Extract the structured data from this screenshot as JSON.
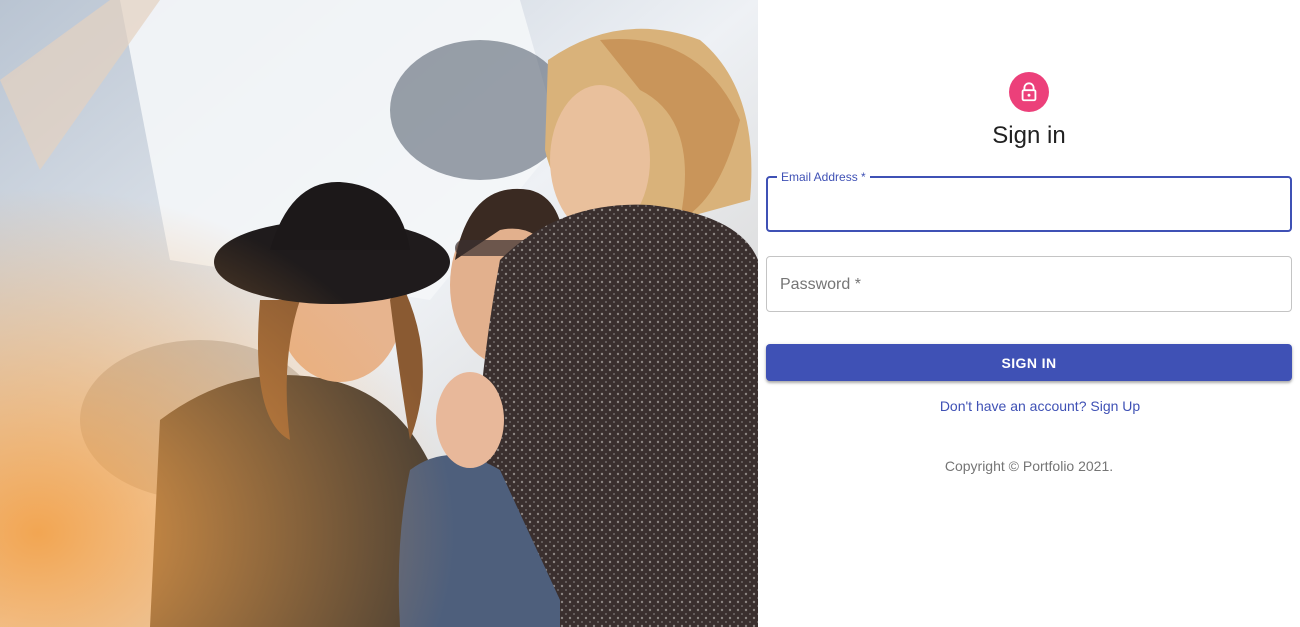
{
  "hero": {
    "image_description_icon": "photo-of-friends-laughing"
  },
  "signin": {
    "lock_icon": "lock-icon",
    "title": "Sign in",
    "email": {
      "label": "Email Address *",
      "value": ""
    },
    "password": {
      "label": "Password *",
      "value": ""
    },
    "button_label": "SIGN IN",
    "signup_link": "Don't have an account? Sign Up",
    "copyright": "Copyright © Portfolio 2021."
  },
  "colors": {
    "primary": "#3f51b5",
    "accent": "#ec407a",
    "text": "#212121",
    "muted": "#757575"
  }
}
